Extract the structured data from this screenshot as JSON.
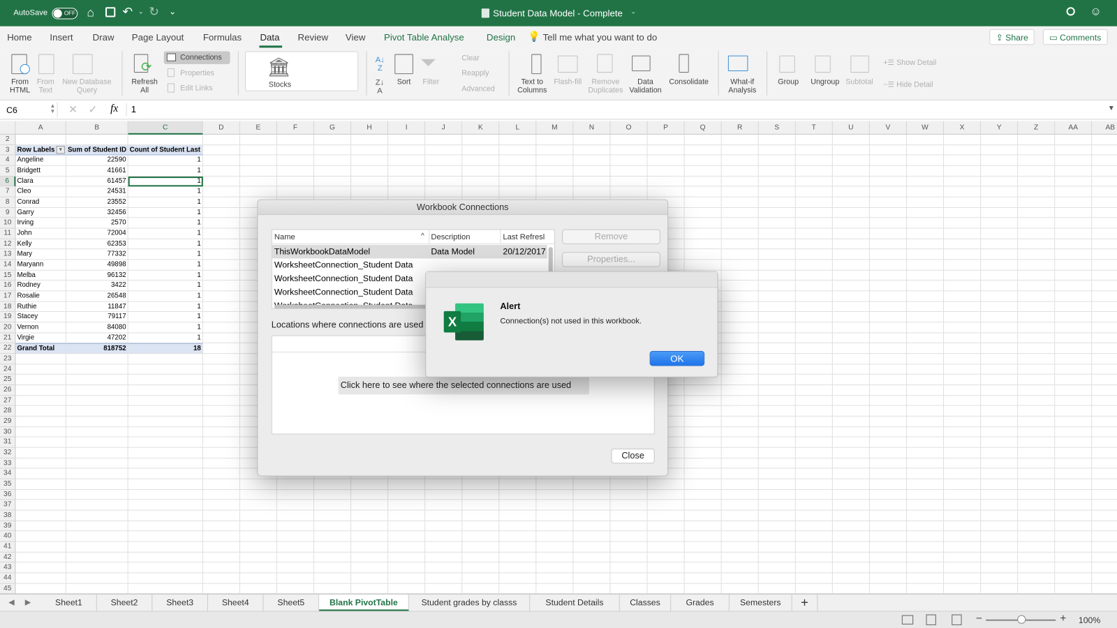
{
  "titlebar": {
    "autosave_label": "AutoSave",
    "autosave_state": "OFF",
    "title": "Student Data Model - Complete"
  },
  "menu_tabs": [
    {
      "label": "Home"
    },
    {
      "label": "Insert"
    },
    {
      "label": "Draw"
    },
    {
      "label": "Page Layout"
    },
    {
      "label": "Formulas"
    },
    {
      "label": "Data",
      "active": true
    },
    {
      "label": "Review"
    },
    {
      "label": "View"
    },
    {
      "label": "Pivot Table Analyse",
      "contextual": true
    },
    {
      "label": "Design",
      "contextual": true
    }
  ],
  "tell_me": "Tell me what you want to do",
  "share_label": "Share",
  "comments_label": "Comments",
  "ribbon": {
    "from_html": "From HTML",
    "from_text": "From Text",
    "new_db_query": "New Database Query",
    "refresh_all": "Refresh All",
    "connections": "Connections",
    "properties": "Properties",
    "edit_links": "Edit Links",
    "stocks": "Stocks",
    "sort": "Sort",
    "filter": "Filter",
    "clear": "Clear",
    "reapply": "Reapply",
    "advanced": "Advanced",
    "text_to_columns": "Text to Columns",
    "flash_fill": "Flash-fill",
    "remove_duplicates": "Remove Duplicates",
    "data_validation": "Data Validation",
    "consolidate": "Consolidate",
    "what_if": "What-if Analysis",
    "group": "Group",
    "ungroup": "Ungroup",
    "subtotal": "Subtotal",
    "show_detail": "Show Detail",
    "hide_detail": "Hide Detail"
  },
  "formula_bar": {
    "name_box": "C6",
    "fx": "fx",
    "value": "1"
  },
  "columns": [
    "A",
    "B",
    "C",
    "D",
    "E",
    "F",
    "G",
    "H",
    "I",
    "J",
    "K",
    "L",
    "M",
    "N",
    "O",
    "P",
    "Q",
    "R",
    "S",
    "T",
    "U",
    "V",
    "W",
    "X",
    "Y",
    "Z",
    "AA",
    "AB"
  ],
  "rows": {
    "first": 2,
    "last": 45,
    "selected": 6
  },
  "pivot": {
    "headers": [
      "Row Labels",
      "Sum of Student ID",
      "Count of Student Last"
    ],
    "rows": [
      [
        "Angeline",
        22590,
        1
      ],
      [
        "Bridgett",
        41661,
        1
      ],
      [
        "Clara",
        61457,
        1
      ],
      [
        "Cleo",
        24531,
        1
      ],
      [
        "Conrad",
        23552,
        1
      ],
      [
        "Garry",
        32456,
        1
      ],
      [
        "Irving",
        2570,
        1
      ],
      [
        "John",
        72004,
        1
      ],
      [
        "Kelly",
        62353,
        1
      ],
      [
        "Mary",
        77332,
        1
      ],
      [
        "Maryann",
        49898,
        1
      ],
      [
        "Melba",
        96132,
        1
      ],
      [
        "Rodney",
        3422,
        1
      ],
      [
        "Rosalie",
        26548,
        1
      ],
      [
        "Ruthie",
        11847,
        1
      ],
      [
        "Stacey",
        79117,
        1
      ],
      [
        "Vernon",
        84080,
        1
      ],
      [
        "Virgie",
        47202,
        1
      ]
    ],
    "total": [
      "Grand Total",
      818752,
      18
    ]
  },
  "sheets": [
    {
      "label": "Sheet1"
    },
    {
      "label": "Sheet2"
    },
    {
      "label": "Sheet3"
    },
    {
      "label": "Sheet4"
    },
    {
      "label": "Sheet5"
    },
    {
      "label": "Blank PivotTable",
      "active": true
    },
    {
      "label": "Student grades by classs"
    },
    {
      "label": "Student Details"
    },
    {
      "label": "Classes"
    },
    {
      "label": "Grades"
    },
    {
      "label": "Semesters"
    }
  ],
  "status": {
    "zoom": "100%",
    "zoom_minus": "−",
    "zoom_plus": "+"
  },
  "connections_dialog": {
    "title": "Workbook Connections",
    "columns": [
      "Name",
      "Description",
      "Last Refresl"
    ],
    "items": [
      {
        "name": "ThisWorkbookDataModel",
        "description": "Data Model",
        "last_refresh": "20/12/2017",
        "selected": true
      },
      {
        "name": "WorksheetConnection_Student Data"
      },
      {
        "name": "WorksheetConnection_Student Data"
      },
      {
        "name": "WorksheetConnection_Student Data"
      },
      {
        "name": "WorksheetConnection_Student Data"
      }
    ],
    "remove": "Remove",
    "properties": "Properties...",
    "locations_label": "Locations where connections are used",
    "click_here": "Click here to see where the selected connections are used",
    "close": "Close"
  },
  "alert": {
    "title": "Alert",
    "message": "Connection(s) not used in this workbook.",
    "ok": "OK",
    "accent": "#2a7ef0"
  },
  "colors": {
    "brand": "#217346",
    "pivot_header": "#dbe4f3"
  }
}
